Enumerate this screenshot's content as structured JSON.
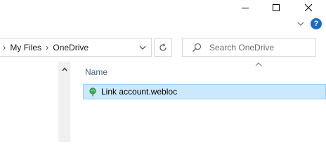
{
  "window": {
    "minimize_icon": "minimize-icon",
    "maximize_icon": "maximize-icon",
    "close_icon": "close-icon"
  },
  "ribbon": {
    "expand_icon": "chevron-down-icon",
    "help_label": "?"
  },
  "address_bar": {
    "breadcrumbs": [
      "My Files",
      "OneDrive"
    ],
    "separator": "›"
  },
  "search": {
    "placeholder": "Search OneDrive"
  },
  "file_list": {
    "columns": [
      "Name"
    ],
    "rows": [
      {
        "name": "Link account.webloc",
        "selected": true,
        "icon": "internet-shortcut-icon"
      }
    ]
  },
  "colors": {
    "selection_bg": "#cce8ff",
    "selection_border": "#99d1ff",
    "help_blue": "#1a69c7",
    "header_text": "#4c607a"
  }
}
